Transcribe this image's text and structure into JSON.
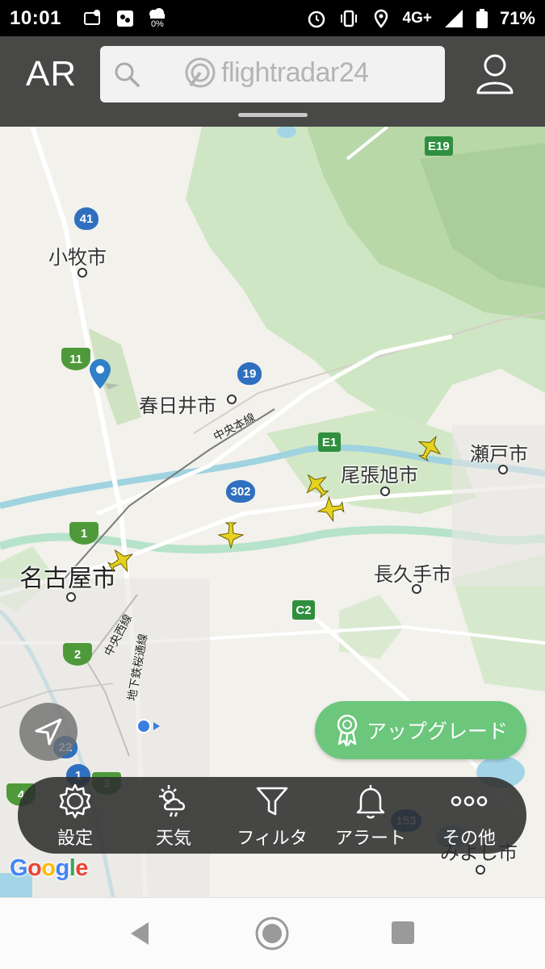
{
  "status_bar": {
    "time": "10:01",
    "weather_percent": "0%",
    "network": "4G+",
    "battery": "71%"
  },
  "header": {
    "ar_label": "AR",
    "logo_text": "flightradar24",
    "search_icon": "search-icon",
    "profile_icon": "user-icon"
  },
  "map": {
    "places": {
      "komaki": "小牧市",
      "kasugai": "春日井市",
      "owariasahi": "尾張旭市",
      "seto": "瀬戸市",
      "nagoya": "名古屋市",
      "nagakute": "長久手市",
      "miyoshi": "みよし市"
    },
    "rail_lines": {
      "chuo_honsen": "中央本線",
      "chuo_nishi": "中央西線",
      "chikatetsu_sakuradori": "地下鉄桜通線"
    },
    "shields": {
      "r41": "41",
      "r11": "11",
      "r19": "19",
      "e19": "E19",
      "e1": "E1",
      "r302": "302",
      "r1": "1",
      "c2": "C2",
      "r2": "2",
      "r22": "22",
      "r1b": "1",
      "r3": "3",
      "r4": "4",
      "r153": "153"
    },
    "attribution": "Google"
  },
  "upgrade_button": {
    "label": "アップグレード",
    "icon": "ribbon-icon"
  },
  "toolbar": {
    "items": [
      {
        "label": "設定",
        "icon": "gear-icon"
      },
      {
        "label": "天気",
        "icon": "weather-icon"
      },
      {
        "label": "フィルタ",
        "icon": "filter-icon"
      },
      {
        "label": "アラート",
        "icon": "bell-icon"
      },
      {
        "label": "その他",
        "icon": "more-icon"
      }
    ]
  },
  "colors": {
    "upgrade_green": "#6cc67c",
    "plane_yellow": "#e6d21e",
    "header_bg": "#303030"
  }
}
